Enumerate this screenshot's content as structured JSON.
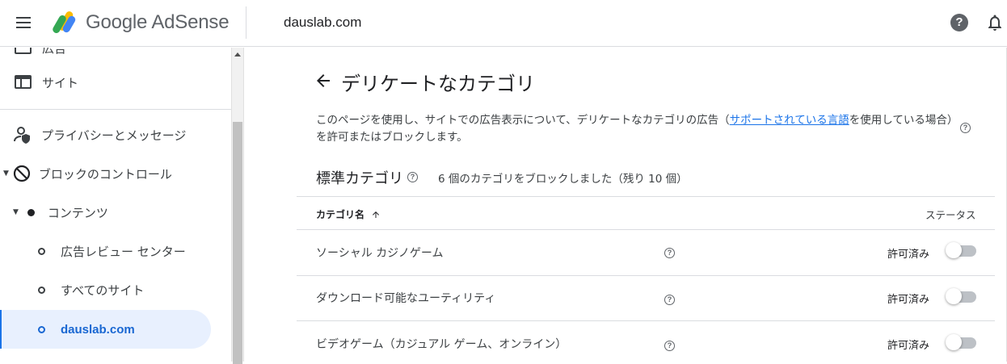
{
  "header": {
    "brand": "Google AdSense",
    "site": "dauslab.com",
    "help_glyph": "?",
    "icons": [
      "menu-icon",
      "adsense-logo",
      "help-icon",
      "bell-icon"
    ]
  },
  "sidebar": {
    "items": [
      {
        "label": "広告",
        "icon": "ads-icon"
      },
      {
        "label": "サイト",
        "icon": "sites-icon"
      },
      {
        "label": "プライバシーとメッセージ",
        "icon": "privacy-icon"
      },
      {
        "label": "ブロックのコントロール",
        "icon": "block-icon"
      },
      {
        "label": "コンテンツ",
        "icon": "dot-icon"
      },
      {
        "label": "広告レビュー センター",
        "icon": "ring-icon"
      },
      {
        "label": "すべてのサイト",
        "icon": "ring-icon"
      },
      {
        "label": "dauslab.com",
        "icon": "ring-icon",
        "active": true
      }
    ]
  },
  "main": {
    "title": "デリケートなカテゴリ",
    "description_before": "このページを使用し、サイトでの広告表示について、デリケートなカテゴリの広告（",
    "description_link": "サポートされている言語",
    "description_after": "を使用している場合）を許可またはブロックします。",
    "section_title": "標準カテゴリ",
    "section_count": "6 個のカテゴリをブロックしました（残り 10 個）",
    "table": {
      "col_name": "カテゴリ名",
      "col_status": "ステータス",
      "rows": [
        {
          "name": "ソーシャル カジノゲーム",
          "status": "許可済み",
          "enabled": false
        },
        {
          "name": "ダウンロード可能なユーティリティ",
          "status": "許可済み",
          "enabled": false
        },
        {
          "name": "ビデオゲーム（カジュアル ゲーム、オンライン）",
          "status": "許可済み",
          "enabled": false
        }
      ]
    }
  },
  "colors": {
    "accent": "#1a73e8",
    "active_bg": "#e8f0fe",
    "divider": "#dadce0",
    "toggle_off": "#bdc1c6"
  }
}
